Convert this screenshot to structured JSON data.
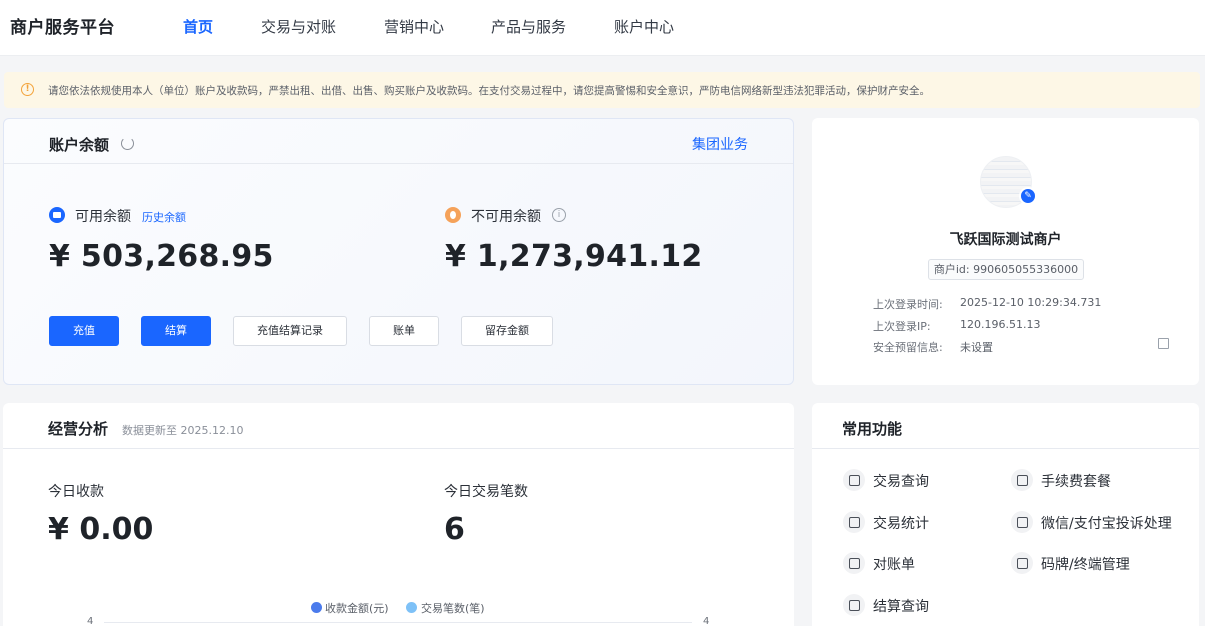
{
  "header": {
    "brand": "商户服务平台",
    "nav": [
      {
        "label": "首页",
        "active": true
      },
      {
        "label": "交易与对账",
        "active": false
      },
      {
        "label": "营销中心",
        "active": false
      },
      {
        "label": "产品与服务",
        "active": false
      },
      {
        "label": "账户中心",
        "active": false
      }
    ]
  },
  "notice": {
    "icon": "warning-circle-icon",
    "text": "请您依法依规使用本人（单位）账户及收款码，严禁出租、出借、出售、购买账户及收款码。在支付交易过程中，请您提高警惕和安全意识，严防电信网络新型违法犯罪活动，保护财产安全。"
  },
  "balance": {
    "title": "账户余额",
    "group_link": "集团业务",
    "available_label": "可用余额",
    "history_link": "历史余额",
    "available_amount": "¥ 503,268.95",
    "unavailable_label": "不可用余额",
    "unavailable_amount": "¥ 1,273,941.12",
    "buttons": [
      "充值",
      "结算",
      "充值结算记录",
      "账单",
      "留存金额"
    ]
  },
  "merchant": {
    "name": "飞跃国际测试商户",
    "id_text": "商户id: 990605055336000",
    "last_login_time_label": "上次登录时间:",
    "last_login_time": "2025-12-10 10:29:34.731",
    "last_login_ip_label": "上次登录IP:",
    "last_login_ip": "120.196.51.13",
    "security_label": "安全预留信息:",
    "security_value": "未设置"
  },
  "operations": {
    "title": "经营分析",
    "update_text": "数据更新至 2025.12.10",
    "today_income_label": "今日收款",
    "today_income_value": "¥ 0.00",
    "today_count_label": "今日交易笔数",
    "today_count_value": "6",
    "legend": [
      {
        "name": "收款金额(元)",
        "color": "#4b7bec"
      },
      {
        "name": "交易笔数(笔)",
        "color": "#7ec1f7"
      }
    ],
    "left_axis_top": "4",
    "right_axis_top": "4"
  },
  "functions": {
    "title": "常用功能",
    "items": [
      {
        "label": "交易查询",
        "icon": "money-bag-icon"
      },
      {
        "label": "手续费套餐",
        "icon": "gift-icon"
      },
      {
        "label": "交易统计",
        "icon": "statistics-icon"
      },
      {
        "label": "微信/支付宝投诉处理",
        "icon": "complaint-icon"
      },
      {
        "label": "对账单",
        "icon": "statement-icon"
      },
      {
        "label": "码牌/终端管理",
        "icon": "qrcode-icon"
      },
      {
        "label": "结算查询",
        "icon": "settlement-icon"
      }
    ]
  }
}
